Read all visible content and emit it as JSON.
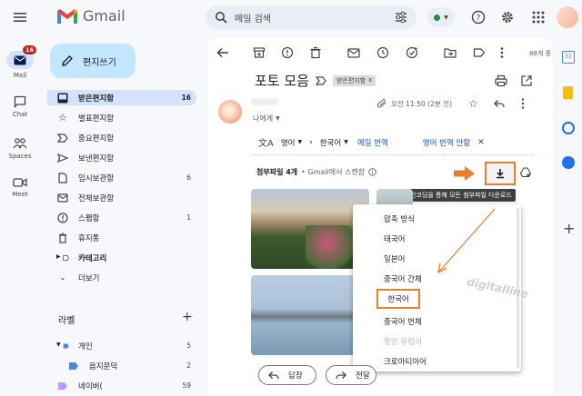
{
  "app": {
    "logo_text": "Gmail",
    "search_placeholder": "메일 검색",
    "avatar_letter": ""
  },
  "rail": {
    "mail_label": "Mail",
    "mail_badge": "16",
    "chat_label": "Chat",
    "spaces_label": "Spaces",
    "meet_label": "Meet"
  },
  "compose": {
    "label": "편지쓰기"
  },
  "nav": [
    {
      "label": "받은편지함",
      "count": "16"
    },
    {
      "label": "별표편지함",
      "count": ""
    },
    {
      "label": "중요편지함",
      "count": ""
    },
    {
      "label": "보낸편지함",
      "count": ""
    },
    {
      "label": "임시보관함",
      "count": "6"
    },
    {
      "label": "전체보관함",
      "count": ""
    },
    {
      "label": "스팸함",
      "count": "1"
    },
    {
      "label": "휴지통",
      "count": ""
    },
    {
      "label": "카테고리",
      "count": ""
    },
    {
      "label": "더보기",
      "count": ""
    }
  ],
  "labels": {
    "heading": "라벨",
    "items": [
      {
        "label": "개인",
        "count": "5"
      },
      {
        "label": "음지문덕",
        "count": "2"
      },
      {
        "label": "네이버(",
        "count": "59"
      }
    ]
  },
  "toolbar": {
    "count_text": "88개 중"
  },
  "email": {
    "subject": "포토 모음",
    "label_chip": "받은편지함",
    "chip_close": "x",
    "time": "오전 11:50 (2분 전)",
    "to": "나에게",
    "translate": {
      "from": "영어",
      "to": "한국어",
      "translate_link": "메일 번역",
      "dont_translate": "영어 번역 안함"
    },
    "attachments_title": "첨부파일 4개",
    "attachments_scanned": "• Gmail에서 스캔함",
    "download_tooltip": "인코딩을 통해 모든 첨부파일 다운로드",
    "reply": "답장",
    "forward": "전달"
  },
  "encoding_menu": {
    "items": [
      "압축 방식",
      "태국어",
      "일본어",
      "중국어 간체",
      "한국어",
      "중국어 번체",
      "중앙 유럽어",
      "크로아티아어"
    ],
    "selected": "한국어"
  },
  "watermark": "digitalline",
  "colors": {
    "accent_orange": "#e8802a",
    "selected_nav": "#d3e3fd",
    "compose_bg": "#c2e7ff",
    "badge_red": "#c5221f"
  }
}
